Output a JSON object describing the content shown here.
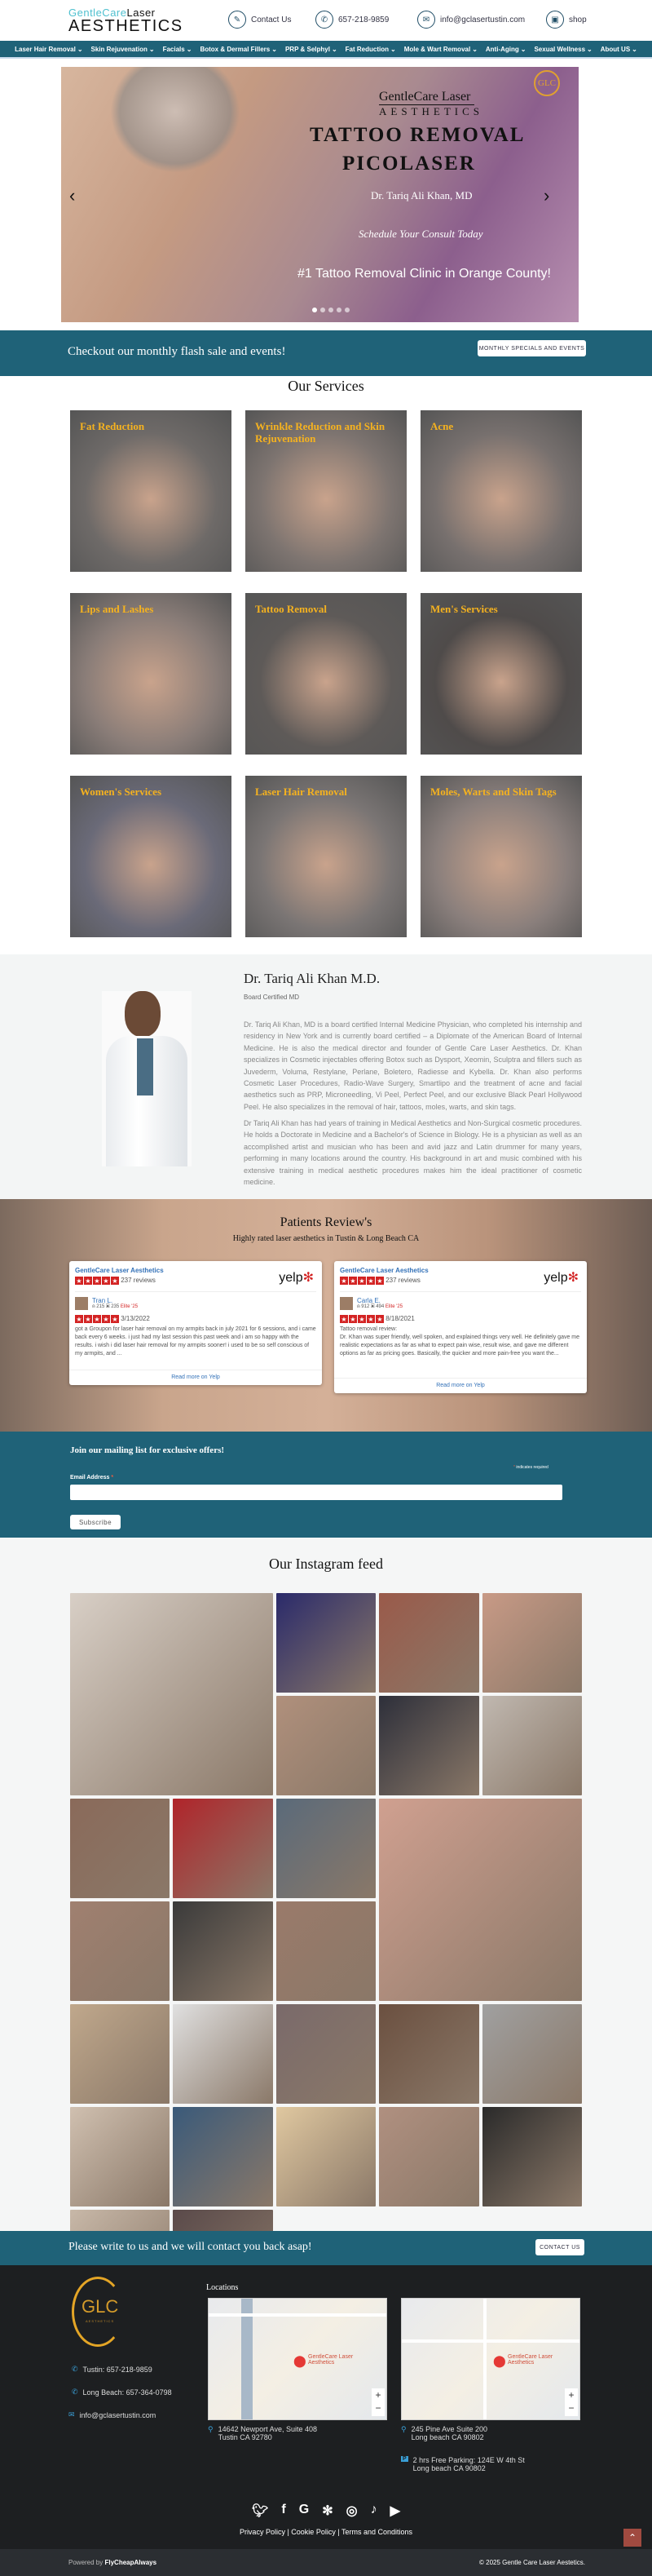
{
  "header": {
    "logo_top_light": "GentleCare",
    "logo_top_dark": "Laser",
    "logo_bottom": "AESTHETICS",
    "contact": "Contact Us",
    "phone": "657-218-9859",
    "email": "info@gclasertustin.com",
    "shop": "shop"
  },
  "nav": [
    "Laser Hair Removal",
    "Skin Rejuvenation",
    "Facials",
    "Botox & Dermal Fillers",
    "PRP & Selphyl",
    "Fat Reduction",
    "Mole & Wart Removal",
    "Anti-Aging",
    "Sexual Wellness",
    "About US"
  ],
  "hero": {
    "brand_top": "GentleCare Laser",
    "brand_bottom": "AESTHETICS",
    "badge": "GLC",
    "title1": "TATTOO REMOVAL",
    "title2": "PICOLASER",
    "doctor": "Dr. Tariq Ali Khan, MD",
    "cta": "Schedule Your Consult Today",
    "tagline": "#1 Tattoo Removal Clinic in Orange County!",
    "slides": 5,
    "active_slide": 1
  },
  "flash": {
    "text": "Checkout our monthly flash sale and events!",
    "button": "MONTHLY SPECIALS AND EVENTS"
  },
  "services": {
    "title": "Our Services",
    "items": [
      "Fat Reduction",
      "Wrinkle Reduction and Skin Rejuvenation",
      "Acne",
      "Lips and Lashes",
      "Tattoo Removal",
      "Men's Services",
      "Women's Services",
      "Laser Hair Removal",
      "Moles, Warts and Skin Tags"
    ]
  },
  "doctor": {
    "name": "Dr. Tariq Ali Khan M.D.",
    "subtitle": "Board Certified MD",
    "p1": "Dr. Tariq Ali Khan, MD is a board certified Internal Medicine Physician, who completed his internship and residency in New York and is currently board certified – a Diplomate of the American Board of Internal Medicine. He is also the medical director and founder of Gentle Care Laser Aesthetics. Dr. Khan specializes in Cosmetic injectables offering Botox such as Dysport, Xeomin, Sculptra and fillers such as Juvederm, Voluma, Restylane, Perlane, Boletero, Radiesse and Kybella. Dr. Khan also performs Cosmetic Laser Procedures, Radio-Wave Surgery, Smartlipo and the treatment of acne and facial aesthetics such as PRP, Microneedling, Vi Peel, Perfect Peel, and our exclusive Black Pearl Hollywood Peel. He also specializes in the removal of hair, tattoos, moles, warts, and skin tags.",
    "p2": "Dr Tariq Ali Khan has had years of training in Medical Aesthetics and Non-Surgical cosmetic procedures. He holds a Doctorate in Medicine and a Bachelor's of Science in Biology. He is a physician as well as an accomplished artist and musician who has been and avid jazz and Latin drummer for many years, performing in many locations around the country. His background in art and music combined with his extensive training in medical aesthetic procedures makes him the ideal practitioner of cosmetic medicine."
  },
  "reviews": {
    "title": "Patients Review's",
    "subtitle": "Highly rated laser aesthetics in Tustin & Long Beach CA",
    "cards": [
      {
        "business": "GentleCare Laser Aesthetics",
        "rating": 4.5,
        "count": "237 reviews",
        "logo": "yelp",
        "user": "Tran L.",
        "friends": "215",
        "reviews": "235",
        "elite": "Elite '25",
        "stars": 5,
        "date": "3/13/2022",
        "text": "got a Groupon for laser hair removal on my armpits back in july 2021 for 6 sessions, and i came back every 6 weeks. i just had my last session this past week and i am so happy with the results. i wish i did laser hair removal for my armpits sooner! i used to be so self conscious of my armpits, and ...",
        "more": "Read more on Yelp"
      },
      {
        "business": "GentleCare Laser Aesthetics",
        "rating": 4.5,
        "count": "237 reviews",
        "logo": "yelp",
        "user": "Carla E.",
        "friends": "912",
        "reviews": "494",
        "elite": "Elite '25",
        "stars": 5,
        "date": "8/18/2021",
        "text": "Tattoo removal review:\nDr. Khan was super friendly, well spoken, and explained things very well. He definitely gave me realistic expectations as far as what to expect pain wise, result wise, and gave me different options as far as pricing goes. Basically, the quicker and more pain-free you want the...",
        "more": "Read more on Yelp"
      }
    ]
  },
  "mailing": {
    "title": "Join our mailing list for exclusive offers!",
    "required_note": "indicates required",
    "email_label": "Email Address",
    "email_value": "",
    "button": "Subscribe"
  },
  "instagram": {
    "title": "Our Instagram feed"
  },
  "contact_bar": {
    "text": "Please write to us and we will contact you back asap!",
    "button": "CONTACT US"
  },
  "footer": {
    "logo": "GLC",
    "logo_sub": "AESTHETICS",
    "phone_tustin": "Tustin: 657-218-9859",
    "phone_lb": "Long Beach: 657-364-0798",
    "email": "info@gclasertustin.com",
    "locations_title": "Locations",
    "map_label": "GentleCare Laser Aesthetics",
    "addr1_l1": "14642 Newport Ave, Suite 408",
    "addr1_l2": "Tustin CA 92780",
    "addr2_l1": "245 Pine Ave Suite 200",
    "addr2_l2": "Long beach CA 90802",
    "parking_l1": "2 hrs Free Parking: 124E W 4th St",
    "parking_l2": "Long beach CA 90802",
    "social": [
      "twitter",
      "facebook",
      "google",
      "yelp",
      "instagram",
      "tiktok",
      "youtube"
    ],
    "links": [
      "Privacy Policy",
      "Cookie Policy",
      "Terms and Conditions"
    ],
    "powered_prefix": "Powered by",
    "powered_by": "FlyCheapAlways",
    "copyright": "2025 Gentle Care Laser Aestetics."
  }
}
